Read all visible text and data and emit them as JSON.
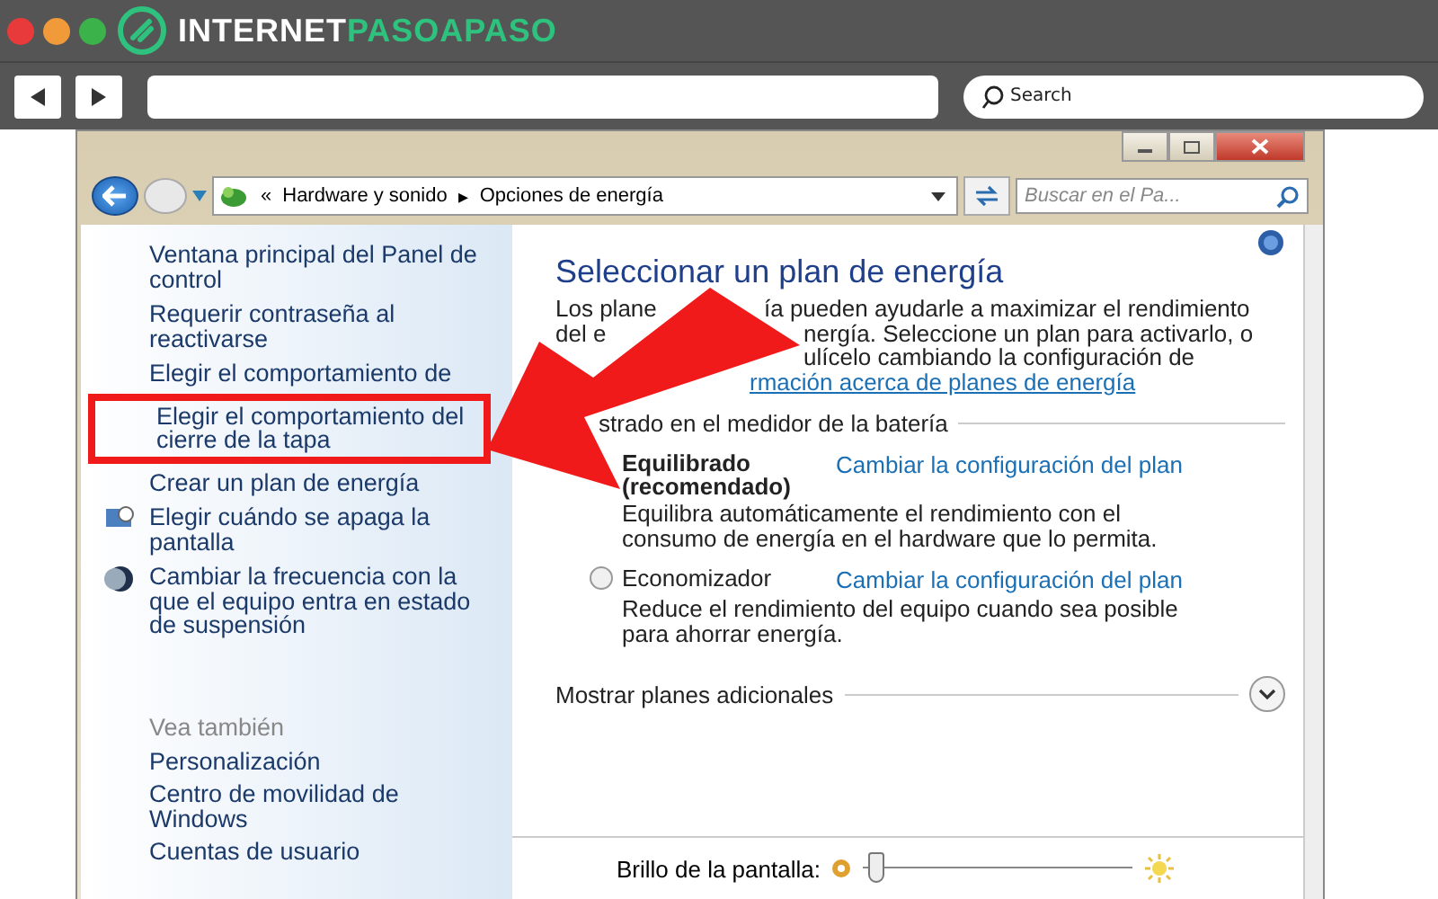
{
  "site_header": {
    "logo_parts": [
      "INTERNET",
      "PASOAPASO"
    ],
    "search": {
      "placeholder": "Search"
    }
  },
  "window": {
    "address": {
      "parts": [
        "«",
        "Hardware y sonido",
        "▸",
        "Opciones de energía"
      ]
    },
    "search": {
      "placeholder": "Buscar en el Pa..."
    }
  },
  "sidebar": {
    "items": [
      {
        "label": "Ventana principal del Panel de control",
        "kind": "link",
        "highlighted": false
      },
      {
        "label": "Requerir contraseña al reactivarse",
        "kind": "link",
        "highlighted": false
      },
      {
        "label": "Elegir el comportamiento de",
        "kind": "link",
        "highlighted": false
      },
      {
        "label": "Elegir el comportamiento del cierre de la tapa",
        "kind": "link",
        "highlighted": true
      },
      {
        "label": "Crear un plan de energía",
        "kind": "link",
        "highlighted": false
      },
      {
        "label": "Elegir cuándo se apaga la pantalla",
        "kind": "monitor",
        "highlighted": false
      },
      {
        "label": "Cambiar la frecuencia con la que el equipo entra en estado de suspensión",
        "kind": "moon",
        "highlighted": false
      }
    ],
    "see_also": {
      "heading": "Vea también",
      "items": [
        "Personalización",
        "Centro de movilidad de Windows",
        "Cuentas de usuario"
      ]
    }
  },
  "main": {
    "title": "Seleccionar un plan de energía",
    "intro_lines": [
      {
        "left": "Los plane",
        "right": "ía pueden ayudarle a maximizar el rendimiento",
        "kind": "text"
      },
      {
        "left": "del e",
        "right": "nergía. Seleccione un plan para activarlo, o",
        "kind": "text"
      },
      {
        "right": "ulícelo cambiando la configuración de",
        "kind": "text"
      },
      {
        "right": "rmación acerca de planes de energía",
        "kind": "link"
      }
    ],
    "group_heading": "strado en el medidor de la batería",
    "plans": [
      {
        "name": "Equilibrado (recomendado)",
        "link": "Cambiar la configuración del plan",
        "description": "Equilibra automáticamente el rendimiento con el consumo de energía en el hardware que lo permita."
      },
      {
        "name": "Economizador",
        "selected": false,
        "link": "Cambiar la configuración del plan",
        "description": "Reduce el rendimiento del equipo cuando sea posible para ahorrar energía."
      }
    ],
    "more_plans": "Mostrar planes adicionales",
    "brightness": {
      "label": "Brillo de la pantalla:",
      "level": 0.02
    }
  }
}
